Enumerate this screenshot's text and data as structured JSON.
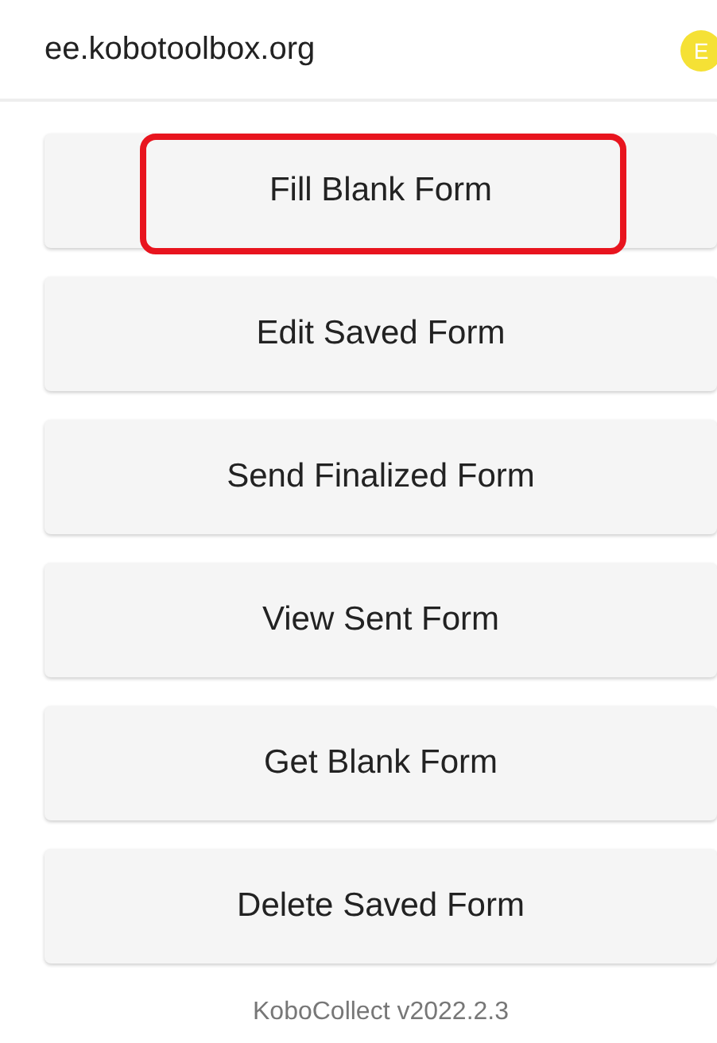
{
  "header": {
    "title": "ee.kobotoolbox.org",
    "avatar": "E"
  },
  "menu": [
    {
      "label": "Fill Blank Form",
      "highlighted": true
    },
    {
      "label": "Edit Saved Form",
      "highlighted": false
    },
    {
      "label": "Send Finalized Form",
      "highlighted": false
    },
    {
      "label": "View Sent Form",
      "highlighted": false
    },
    {
      "label": "Get Blank Form",
      "highlighted": false
    },
    {
      "label": "Delete Saved Form",
      "highlighted": false
    }
  ],
  "footer": "KoboCollect v2022.2.3"
}
